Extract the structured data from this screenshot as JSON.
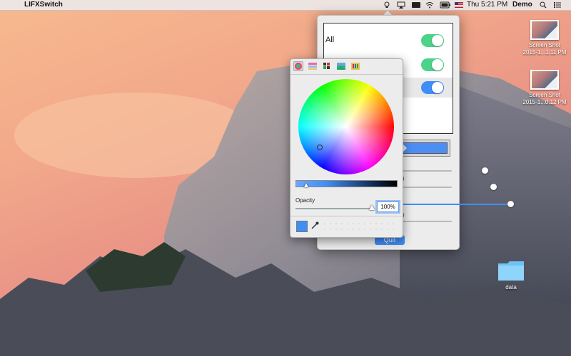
{
  "menubar": {
    "apple_glyph": "",
    "app_name": "LIFXSwitch",
    "clock": "Thu 5:21 PM",
    "user": "Demo",
    "status_icons": [
      "lightbulb-icon",
      "airplay-icon",
      "battery-status-icon",
      "wifi-icon",
      "battery-icon",
      "flag-icon",
      "search-icon",
      "list-icon"
    ]
  },
  "desktop_icons": [
    {
      "line1": "Screen Shot",
      "line2": "2015-1...1.11 PM"
    },
    {
      "line1": "Screen Shot",
      "line2": "2015-1...0.12 PM"
    },
    {
      "line1": "data",
      "line2": ""
    }
  ],
  "lights": [
    {
      "label": "All",
      "on": true,
      "color": "#4cd38a"
    },
    {
      "label": "",
      "on": true,
      "color": "#4cd38a"
    },
    {
      "label": "",
      "on": true,
      "color": "#3f8ef7",
      "selected": true
    }
  ],
  "controls": {
    "color_well_hex": "#4d8ef5",
    "slider_labels": [
      "0",
      "0"
    ],
    "sliders": [
      0.2,
      0.4,
      0.6,
      0.8,
      0.0
    ],
    "quit_label": "Quit"
  },
  "color_picker": {
    "tabs": [
      "color-wheel-icon",
      "color-sliders-icon",
      "color-palettes-icon",
      "image-palettes-icon",
      "crayons-icon"
    ],
    "opacity_label": "Opacity",
    "opacity_value": "100%",
    "current_color": "#3f8ef7",
    "brightness": 0.1
  },
  "colors": {
    "accent": "#3f8ef7",
    "toggle_green": "#4cd38a"
  }
}
